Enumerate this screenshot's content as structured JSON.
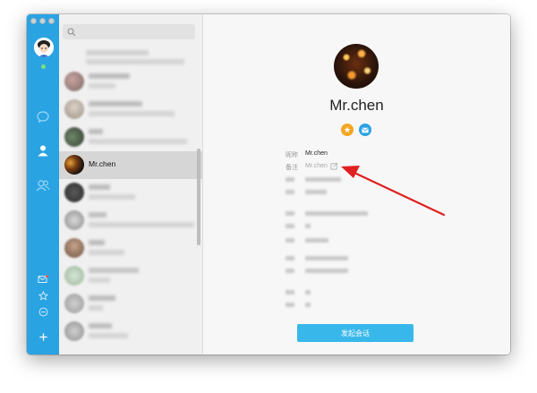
{
  "search": {
    "placeholder": ""
  },
  "list": {
    "active_name": "Mr.chen"
  },
  "profile": {
    "display_name": "Mr.chen",
    "fields": {
      "nickname_label": "昵称",
      "nickname_value": "Mr.chen",
      "remark_label": "备注",
      "remark_value": "Mr.chen"
    },
    "start_chat_label": "发起会话"
  },
  "colors": {
    "sidebar": "#2aa3e3",
    "badge_star": "#f5a623",
    "badge_mail": "#2aa3e3",
    "button": "#38b8ea",
    "arrow": "#e02020"
  },
  "icons": {
    "sidebar_top": [
      "chat-bubble-icon",
      "contact-person-icon",
      "group-icon"
    ],
    "sidebar_bottom": [
      "mail-icon",
      "star-icon",
      "minus-circle-icon",
      "plus-icon"
    ]
  }
}
